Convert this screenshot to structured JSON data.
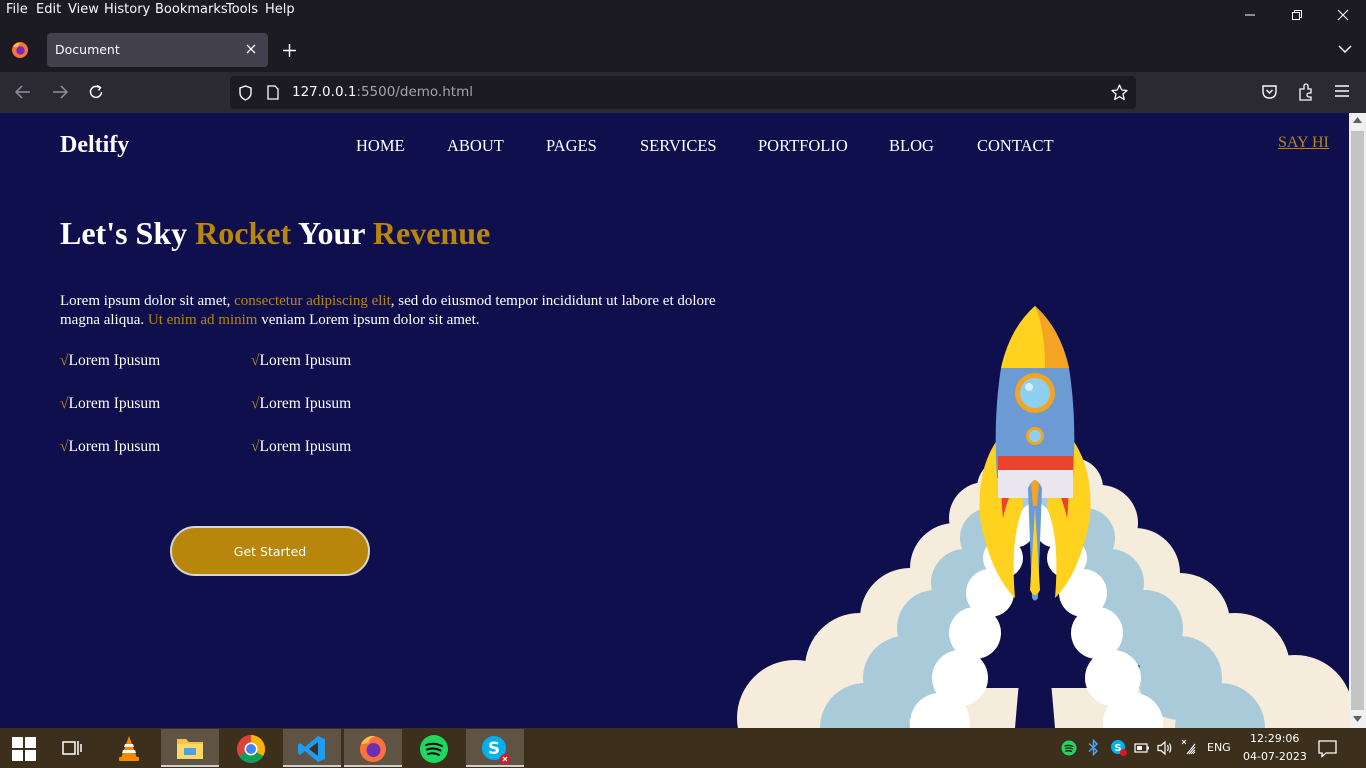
{
  "browser": {
    "menu": [
      "File",
      "Edit",
      "View",
      "History",
      "Bookmarks",
      "Tools",
      "Help"
    ],
    "tab_title": "Document",
    "url_host": "127.0.0.1",
    "url_rest": ":5500/demo.html"
  },
  "page": {
    "brand": "Deltify",
    "nav": [
      "HOME",
      "ABOUT",
      "PAGES",
      "SERVICES",
      "PORTFOLIO",
      "BLOG",
      "CONTACT"
    ],
    "say_hi": "SAY HI",
    "hero": {
      "title_part1": "Let's Sky ",
      "title_highlight1": "Rocket",
      "title_part2": " Your ",
      "title_highlight2": "Revenue",
      "text_1": "Lorem ipsum dolor sit amet, ",
      "text_highlight1": "consectetur adipiscing elit",
      "text_2": ", sed do eiusmod tempor incididunt ut labore et dolore magna aliqua. ",
      "text_highlight2": "Ut enim ad minim",
      "text_3": " veniam Lorem ipsum dolor sit amet."
    },
    "check_mark": "√",
    "features": [
      "Lorem Ipusum",
      "Lorem Ipusum",
      "Lorem Ipusum",
      "Lorem Ipusum",
      "Lorem Ipusum",
      "Lorem Ipusum"
    ],
    "cta_label": "Get Started"
  },
  "taskbar": {
    "apps": [
      "start",
      "task-view",
      "vlc",
      "file-explorer",
      "chrome",
      "vscode",
      "firefox",
      "spotify",
      "skype"
    ],
    "lang": "ENG",
    "time": "12:29:06",
    "date": "04-07-2023"
  },
  "colors": {
    "page_bg": "#0f0f4d",
    "accent_gold": "#b8860b",
    "chrome_dark": "#1c1b22",
    "toolbar": "#2b2a33",
    "taskbar": "#3c2f1c"
  }
}
